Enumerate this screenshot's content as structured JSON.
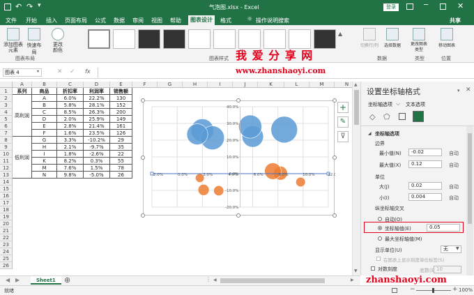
{
  "titlebar": {
    "quick_access": [
      "save-icon",
      "undo-icon",
      "redo-icon",
      "more-icon"
    ],
    "title": "气泡图.xlsx - Excel",
    "login": "登录"
  },
  "tabs": [
    "文件",
    "开始",
    "插入",
    "页面布局",
    "公式",
    "数据",
    "审阅",
    "视图",
    "帮助",
    "图表设计",
    "格式"
  ],
  "active_tab": "图表设计",
  "tell_me": "操作说明搜索",
  "share": "共享",
  "ribbon": {
    "add_element": "添加图表元素",
    "quick_layout": "快速布局",
    "change_colors": "更改颜色",
    "group_layout": "图表布局",
    "group_styles": "图表样式",
    "switch_rowcol": "切换行/列",
    "select_data": "选择数据",
    "group_data": "数据",
    "change_type": "更改图表类型",
    "group_type": "类型",
    "move_chart": "移动图表",
    "group_location": "位置"
  },
  "watermark": {
    "cn": "我 爱 分 享 网",
    "url": "www.zhanshaoyi.com",
    "bottom": "zhanshaoyi.com"
  },
  "formula": {
    "name_box": "图表 4",
    "fx": "fx"
  },
  "columns": [
    "A",
    "B",
    "C",
    "D",
    "E",
    "F",
    "G",
    "H",
    "I",
    "J",
    "K",
    "L",
    "M",
    "N"
  ],
  "rows": [
    "1",
    "2",
    "3",
    "4",
    "5",
    "6",
    "7",
    "8",
    "9",
    "10",
    "11",
    "12",
    "13",
    "14",
    "15",
    "16",
    "17",
    "18",
    "19",
    "20",
    "21",
    "22",
    "23",
    "24",
    "25",
    "26"
  ],
  "table": {
    "headers": [
      "系列",
      "商品",
      "折扣率",
      "利润率",
      "销售额"
    ],
    "groups": [
      "高利润",
      "低利润"
    ],
    "rows": [
      [
        "A",
        "6.0%",
        "22.2%",
        "130"
      ],
      [
        "B",
        "5.8%",
        "28.1%",
        "152"
      ],
      [
        "C",
        "8.5%",
        "26.3%",
        "200"
      ],
      [
        "D",
        "2.0%",
        "25.9%",
        "149"
      ],
      [
        "E",
        "2.8%",
        "21.4%",
        "161"
      ],
      [
        "F",
        "1.6%",
        "23.5%",
        "126"
      ],
      [
        "G",
        "3.3%",
        "-10.2%",
        "29"
      ],
      [
        "H",
        "2.1%",
        "-9.7%",
        "35"
      ],
      [
        "I",
        "1.8%",
        "-2.6%",
        "22"
      ],
      [
        "K",
        "8.2%",
        "0.3%",
        "55"
      ],
      [
        "M",
        "7.6%",
        "1.5%",
        "78"
      ],
      [
        "N",
        "9.8%",
        "-5.0%",
        "26"
      ]
    ]
  },
  "chart_data": {
    "type": "scatter",
    "xlim": [
      -0.02,
      0.12
    ],
    "ylim": [
      -0.2,
      0.4
    ],
    "x_ticks": [
      "-2.0%",
      "0.0%",
      "2.0%",
      "4.0%",
      "6.0%",
      "8.0%",
      "10.0%",
      "12.0%"
    ],
    "y_ticks": [
      "40.0%",
      "30.0%",
      "20.0%",
      "10.0%",
      "0.0%",
      "-10.0%",
      "-20.0%"
    ],
    "y_axis_crosses": 0.05,
    "series": [
      {
        "color": "#5b9bd5",
        "points": [
          [
            0.06,
            0.222,
            130
          ],
          [
            0.058,
            0.281,
            152
          ],
          [
            0.085,
            0.263,
            200
          ],
          [
            0.02,
            0.259,
            149
          ],
          [
            0.028,
            0.214,
            161
          ],
          [
            0.016,
            0.235,
            126
          ]
        ]
      },
      {
        "color": "#ed7d31",
        "points": [
          [
            0.033,
            -0.102,
            29
          ],
          [
            0.021,
            -0.097,
            35
          ],
          [
            0.018,
            -0.026,
            22
          ],
          [
            0.082,
            0.003,
            55
          ],
          [
            0.076,
            0.015,
            78
          ],
          [
            0.098,
            -0.05,
            26
          ]
        ]
      }
    ]
  },
  "chart_tools": [
    "plus-icon",
    "brush-icon",
    "filter-icon"
  ],
  "pane": {
    "title": "设置坐标轴格式",
    "tab1": "坐标轴选项",
    "tab2": "文本选项",
    "section": "坐标轴选项",
    "bounds": "边界",
    "min_label": "最小值(N)",
    "min_value": "-0.02",
    "max_label": "最大值(X)",
    "max_value": "0.12",
    "auto": "自动",
    "units": "单位",
    "major_label": "大(J)",
    "major_value": "0.02",
    "minor_label": "小(I)",
    "minor_value": "0.004",
    "cross_title": "纵坐标轴交叉",
    "auto_radio": "自动(O)",
    "axis_value_radio": "坐标轴值(E)",
    "axis_value": "0.05",
    "max_radio": "最大坐标轴值(M)",
    "display_units": "显示单位(U)",
    "display_units_value": "无",
    "show_label": "在图表上显示刻度单位标签(S)",
    "log_scale": "对数刻度",
    "base_label": "底数(B)",
    "base_value": "10"
  },
  "sheet": {
    "name": "Sheet1"
  },
  "status": {
    "ready": "就绪",
    "zoom": "100%"
  }
}
